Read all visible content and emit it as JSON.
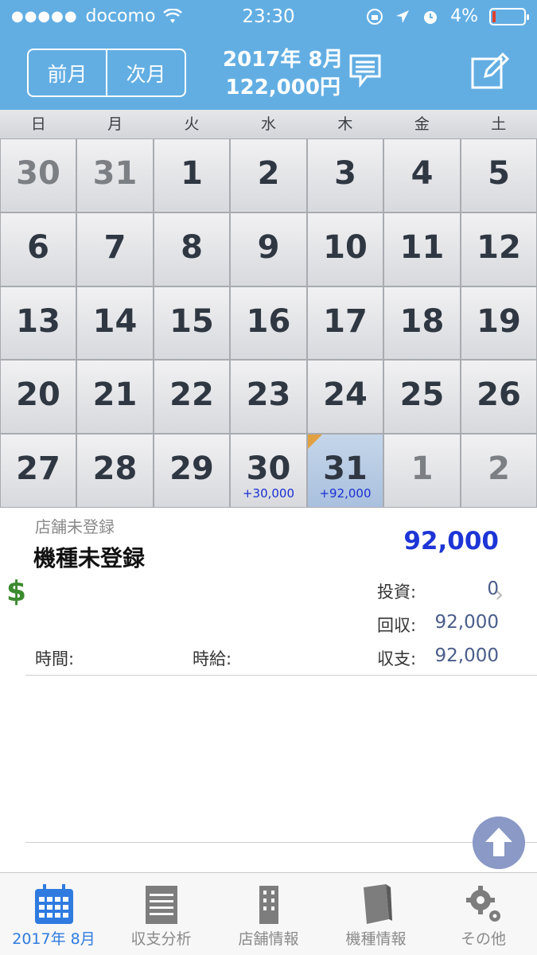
{
  "status": {
    "carrier": "docomo",
    "time": "23:30",
    "battery": "4%"
  },
  "header": {
    "prev_label": "前月",
    "next_label": "次月",
    "month": "2017年 8月",
    "total": "122,000円"
  },
  "calendar": {
    "weekdays": [
      "日",
      "月",
      "火",
      "水",
      "木",
      "金",
      "土"
    ],
    "weeks": [
      [
        "30",
        "31",
        "1",
        "2",
        "3",
        "4",
        "5"
      ],
      [
        "6",
        "7",
        "8",
        "9",
        "10",
        "11",
        "12"
      ],
      [
        "13",
        "14",
        "15",
        "16",
        "17",
        "18",
        "19"
      ],
      [
        "20",
        "21",
        "22",
        "23",
        "24",
        "25",
        "26"
      ],
      [
        "27",
        "28",
        "29",
        "30",
        "31",
        "1",
        "2"
      ]
    ],
    "amounts": {
      "w4d3": "+30,000",
      "w4d4": "+92,000"
    }
  },
  "detail": {
    "store": "店舗未登録",
    "machine": "機種未登録",
    "total": "92,000",
    "invest_label": "投資:",
    "invest_value": "0",
    "return_label": "回収:",
    "return_value": "92,000",
    "balance_label": "収支:",
    "balance_value": "92,000",
    "time_label": "時間:",
    "wage_label": "時給:"
  },
  "tabs": [
    {
      "label": "2017年 8月",
      "icon": "calendar-icon"
    },
    {
      "label": "収支分析",
      "icon": "notepad-icon"
    },
    {
      "label": "店舗情報",
      "icon": "building-icon"
    },
    {
      "label": "機種情報",
      "icon": "book-icon"
    },
    {
      "label": "その他",
      "icon": "gear-icon"
    }
  ],
  "colors": {
    "header_bg": "#62aee3",
    "amount_blue": "#1d35d6",
    "tab_active": "#2f7be0"
  }
}
